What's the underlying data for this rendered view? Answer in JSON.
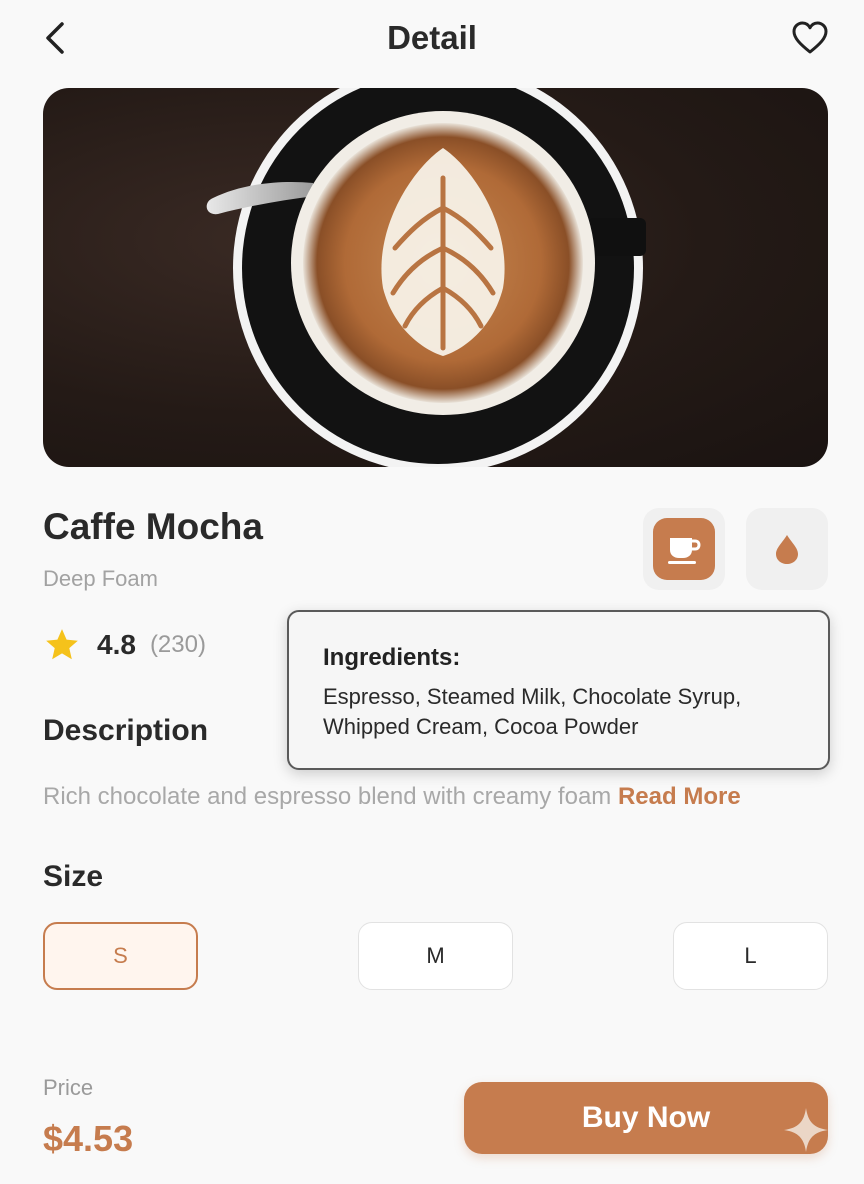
{
  "header": {
    "title": "Detail",
    "back_icon": "chevron-left-icon",
    "favorite_icon": "heart-outline-icon"
  },
  "hero": {
    "image": "latte-art-cup-photo"
  },
  "product": {
    "name": "Caffe Mocha",
    "subtitle": "Deep Foam",
    "rating": "4.8",
    "reviews": "(230)",
    "features": [
      {
        "icon": "coffee-cup-icon",
        "active": true
      },
      {
        "icon": "milk-drop-icon",
        "active": false
      }
    ]
  },
  "tooltip": {
    "title": "Ingredients:",
    "body": "Espresso, Steamed Milk, Chocolate Syrup, Whipped Cream, Cocoa Powder"
  },
  "description": {
    "title": "Description",
    "text": "Rich chocolate and espresso blend with creamy foam ",
    "read_more": "Read More"
  },
  "size": {
    "title": "Size",
    "options": [
      "S",
      "M",
      "L"
    ],
    "selected": "S"
  },
  "footer": {
    "price_label": "Price",
    "price": "$4.53",
    "buy_label": "Buy Now"
  },
  "colors": {
    "accent": "#c67c4e",
    "accent_light": "#fff5ee",
    "background": "#f9f9f9",
    "star": "#f5c21b"
  }
}
